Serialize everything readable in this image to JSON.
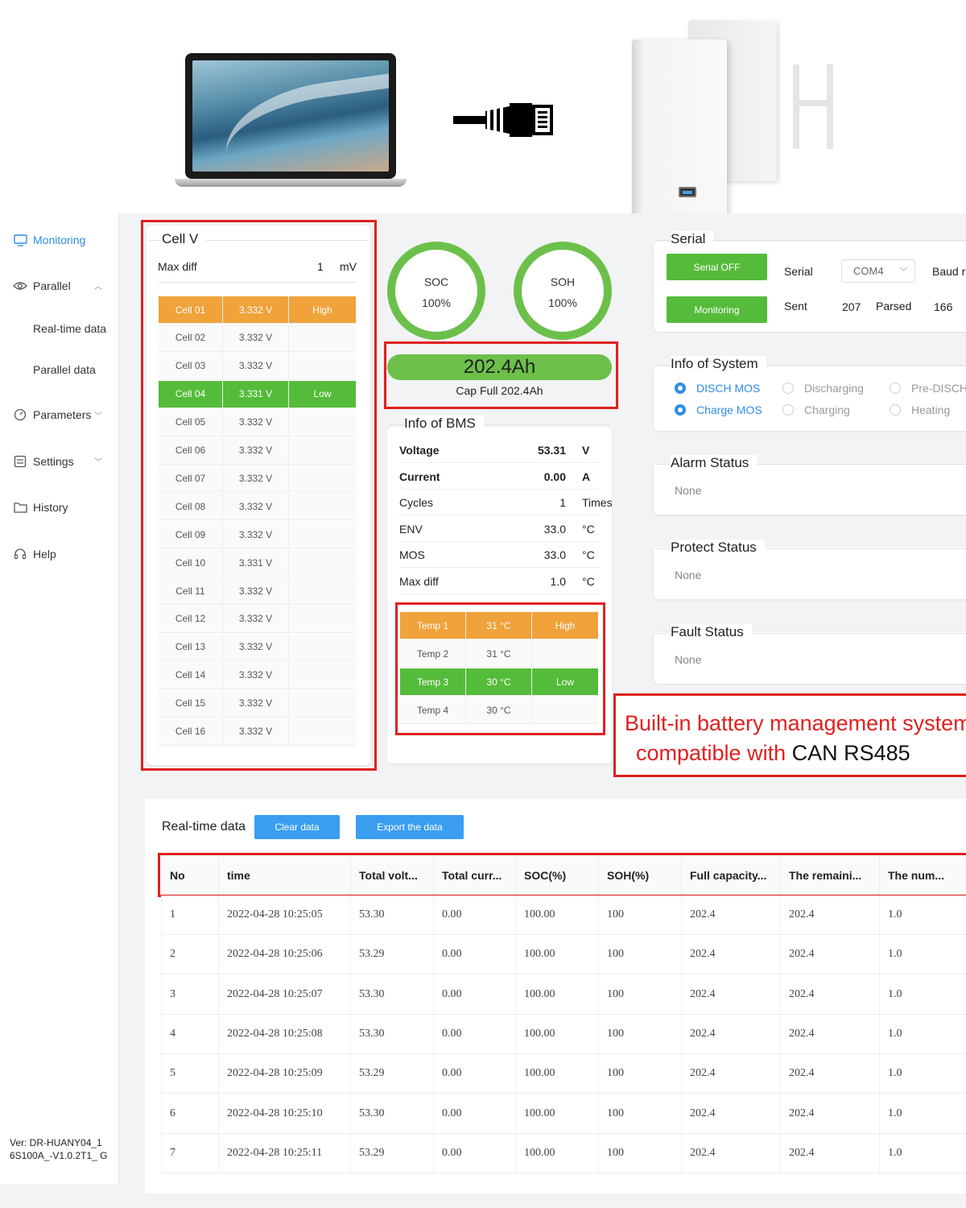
{
  "sidebar": {
    "items": [
      {
        "label": "Monitoring",
        "icon": "monitor-icon"
      },
      {
        "label": "Parallel",
        "icon": "eye-icon"
      },
      {
        "label": "Real-time data"
      },
      {
        "label": "Parallel data"
      },
      {
        "label": "Parameters",
        "icon": "gauge-icon"
      },
      {
        "label": "Settings",
        "icon": "settings-icon"
      },
      {
        "label": "History",
        "icon": "folder-icon"
      },
      {
        "label": "Help",
        "icon": "headset-icon"
      }
    ],
    "version": "Ver: DR-HUANY04_1 6S100A_-V1.0.2T1_ G"
  },
  "cellv": {
    "title": "Cell V",
    "maxdiff_label": "Max diff",
    "maxdiff_value": "1",
    "maxdiff_unit": "mV",
    "cells": [
      {
        "name": "Cell 01",
        "v": "3.332 V",
        "flag": "High"
      },
      {
        "name": "Cell 02",
        "v": "3.332 V",
        "flag": ""
      },
      {
        "name": "Cell 03",
        "v": "3.332 V",
        "flag": ""
      },
      {
        "name": "Cell 04",
        "v": "3.331 V",
        "flag": "Low"
      },
      {
        "name": "Cell 05",
        "v": "3.332 V",
        "flag": ""
      },
      {
        "name": "Cell 06",
        "v": "3.332 V",
        "flag": ""
      },
      {
        "name": "Cell 07",
        "v": "3.332 V",
        "flag": ""
      },
      {
        "name": "Cell 08",
        "v": "3.332 V",
        "flag": ""
      },
      {
        "name": "Cell 09",
        "v": "3.332 V",
        "flag": ""
      },
      {
        "name": "Cell 10",
        "v": "3.331 V",
        "flag": ""
      },
      {
        "name": "Cell 11",
        "v": "3.332 V",
        "flag": ""
      },
      {
        "name": "Cell 12",
        "v": "3.332 V",
        "flag": ""
      },
      {
        "name": "Cell 13",
        "v": "3.332 V",
        "flag": ""
      },
      {
        "name": "Cell 14",
        "v": "3.332 V",
        "flag": ""
      },
      {
        "name": "Cell 15",
        "v": "3.332 V",
        "flag": ""
      },
      {
        "name": "Cell 16",
        "v": "3.332 V",
        "flag": ""
      }
    ]
  },
  "soc": {
    "label": "SOC",
    "value": "100%"
  },
  "soh": {
    "label": "SOH",
    "value": "100%"
  },
  "capacity": {
    "value": "202.4Ah",
    "sub": "Cap Full  202.4Ah"
  },
  "bms": {
    "title": "Info of BMS",
    "rows": [
      {
        "k": "Voltage",
        "v": "53.31",
        "u": "V"
      },
      {
        "k": "Current",
        "v": "0.00",
        "u": "A"
      },
      {
        "k": "Cycles",
        "v": "1",
        "u": "Times"
      },
      {
        "k": "ENV",
        "v": "33.0",
        "u": "°C"
      },
      {
        "k": "MOS",
        "v": "33.0",
        "u": "°C"
      },
      {
        "k": "Max diff",
        "v": "1.0",
        "u": "°C"
      }
    ],
    "temps": [
      {
        "name": "Temp 1",
        "v": "31 °C",
        "flag": "High"
      },
      {
        "name": "Temp 2",
        "v": "31 °C",
        "flag": ""
      },
      {
        "name": "Temp 3",
        "v": "30 °C",
        "flag": "Low"
      },
      {
        "name": "Temp 4",
        "v": "30 °C",
        "flag": ""
      }
    ]
  },
  "serial": {
    "title": "Serial",
    "off_button": "Serial OFF",
    "monitoring_button": "Monitoring",
    "serial_label": "Serial",
    "port": "COM4",
    "baud_label": "Baud r",
    "sent_label": "Sent",
    "sent_value": "207",
    "parsed_label": "Parsed",
    "parsed_value": "166"
  },
  "system": {
    "title": "Info of System",
    "row1": [
      {
        "label": "DISCH MOS",
        "on": true
      },
      {
        "label": "Discharging",
        "on": false
      },
      {
        "label": "Pre-DISCH",
        "on": false
      }
    ],
    "row2": [
      {
        "label": "Charge MOS",
        "on": true
      },
      {
        "label": "Charging",
        "on": false
      },
      {
        "label": "Heating",
        "on": false
      }
    ]
  },
  "alarm": {
    "title": "Alarm Status",
    "value": "None"
  },
  "protect": {
    "title": "Protect Status",
    "value": "None"
  },
  "fault": {
    "title": "Fault Status",
    "value": "None"
  },
  "callout": {
    "line1": "Built-in battery management system",
    "line2_red": "compatible with",
    "line2_black": "CAN RS485"
  },
  "realtime": {
    "title": "Real-time data",
    "clear_button": "Clear data",
    "export_button": "Export the data",
    "columns": [
      "No",
      "time",
      "Total volt...",
      "Total curr...",
      "SOC(%)",
      "SOH(%)",
      "Full capacity...",
      "The remaini...",
      "The num..."
    ],
    "rows": [
      [
        "1",
        "2022-04-28 10:25:05",
        "53.30",
        "0.00",
        "100.00",
        "100",
        "202.4",
        "202.4",
        "1.0"
      ],
      [
        "2",
        "2022-04-28 10:25:06",
        "53.29",
        "0.00",
        "100.00",
        "100",
        "202.4",
        "202.4",
        "1.0"
      ],
      [
        "3",
        "2022-04-28 10:25:07",
        "53.30",
        "0.00",
        "100.00",
        "100",
        "202.4",
        "202.4",
        "1.0"
      ],
      [
        "4",
        "2022-04-28 10:25:08",
        "53.30",
        "0.00",
        "100.00",
        "100",
        "202.4",
        "202.4",
        "1.0"
      ],
      [
        "5",
        "2022-04-28 10:25:09",
        "53.29",
        "0.00",
        "100.00",
        "100",
        "202.4",
        "202.4",
        "1.0"
      ],
      [
        "6",
        "2022-04-28 10:25:10",
        "53.30",
        "0.00",
        "100.00",
        "100",
        "202.4",
        "202.4",
        "1.0"
      ],
      [
        "7",
        "2022-04-28 10:25:11",
        "53.29",
        "0.00",
        "100.00",
        "100",
        "202.4",
        "202.4",
        "1.0"
      ]
    ]
  },
  "colors": {
    "accent": "#2f8de4",
    "green": "#55bb3a",
    "orange": "#f0a23b",
    "red": "#e02020",
    "blue_button": "#3a9ef0"
  }
}
